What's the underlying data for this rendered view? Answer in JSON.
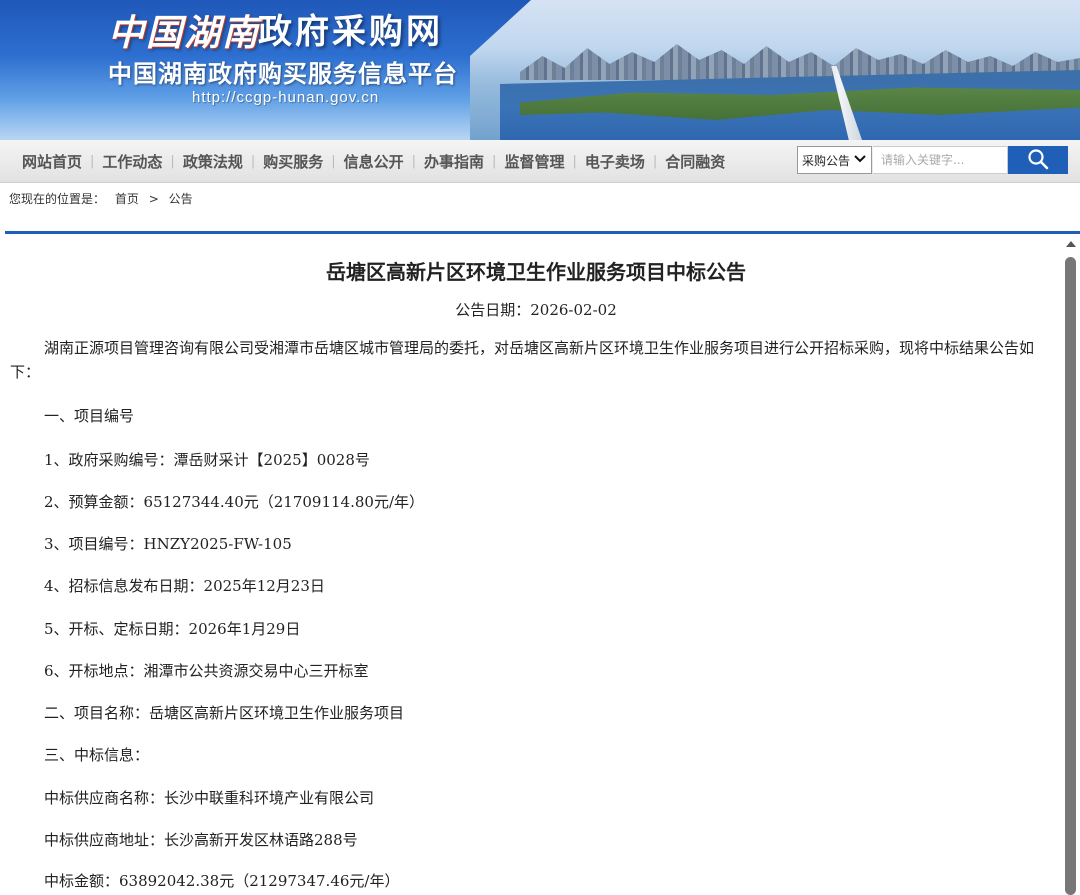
{
  "header": {
    "logo_script": "中国湖南",
    "site_name": "政府采购网",
    "platform_name": "中国湖南政府购买服务信息平台",
    "url": "http://ccgp-hunan.gov.cn"
  },
  "nav": {
    "items": [
      "网站首页",
      "工作动态",
      "政策法规",
      "购买服务",
      "信息公开",
      "办事指南",
      "监督管理",
      "电子卖场",
      "合同融资"
    ],
    "search_select": "采购公告",
    "search_placeholder": "请输入关键字..."
  },
  "breadcrumb": {
    "prefix": "您现在的位置是：",
    "items": [
      "首页",
      "公告"
    ],
    "separator": ">"
  },
  "article": {
    "title": "岳塘区高新片区环境卫生作业服务项目中标公告",
    "date": "公告日期：2026-02-02",
    "intro": "湖南正源项目管理咨询有限公司受湘潭市岳塘区城市管理局的委托，对岳塘区高新片区环境卫生作业服务项目进行公开招标采购，现将中标结果公告如下：",
    "lines": [
      "一、项目编号",
      "1、政府采购编号：潭岳财采计【2025】0028号",
      "2、预算金额：65127344.40元（21709114.80元/年）",
      "3、项目编号：HNZY2025-FW-105",
      "4、招标信息发布日期：2025年12月23日",
      "5、开标、定标日期：2026年1月29日",
      "6、开标地点：湘潭市公共资源交易中心三开标室",
      "二、项目名称：岳塘区高新片区环境卫生作业服务项目",
      "三、中标信息：",
      "中标供应商名称：长沙中联重科环境产业有限公司",
      "中标供应商地址：长沙高新开发区林语路288号",
      "中标金额：63892042.38元（21297347.46元/年）"
    ]
  },
  "colors": {
    "brand_blue": "#1f5fb8",
    "nav_bg": "#e8e8e8"
  }
}
